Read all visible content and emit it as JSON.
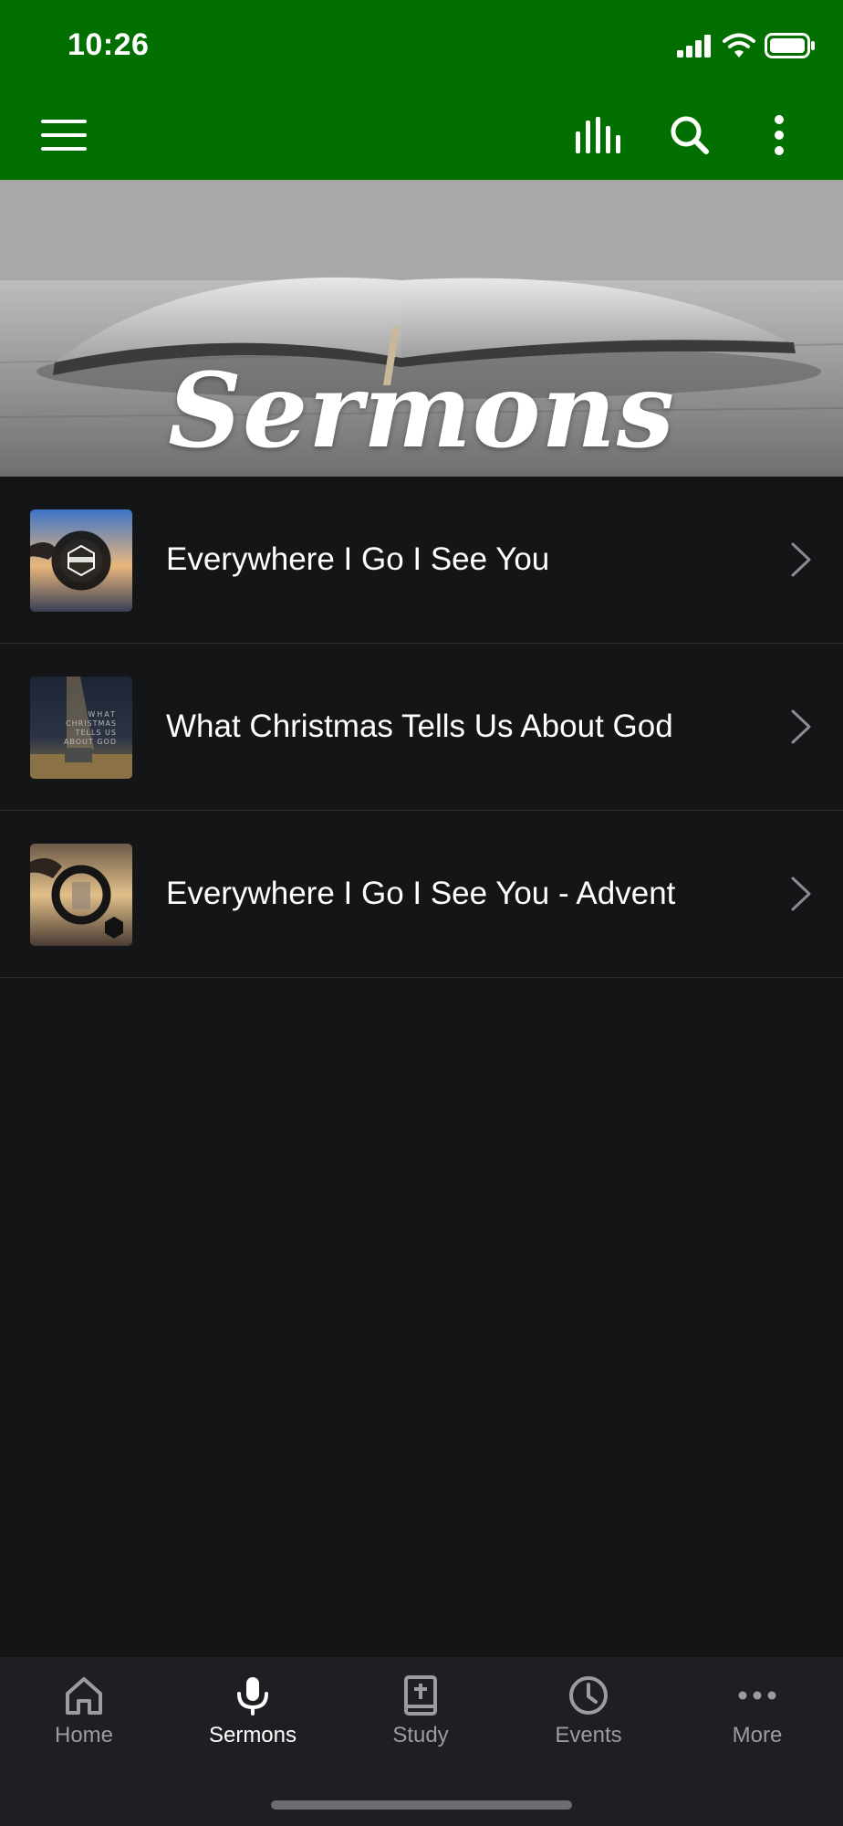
{
  "status_bar": {
    "time": "10:26"
  },
  "header": {
    "icons": [
      "menu-icon",
      "equalizer-icon",
      "search-icon",
      "more-vertical-icon"
    ]
  },
  "banner": {
    "title": "Sermons"
  },
  "sermons": [
    {
      "title": "Everywhere I Go I See You"
    },
    {
      "title": "What Christmas Tells Us About God"
    },
    {
      "title": "Everywhere I Go I See You - Advent"
    }
  ],
  "tabs": [
    {
      "label": "Home",
      "icon": "home-icon"
    },
    {
      "label": "Sermons",
      "icon": "microphone-icon",
      "active": true
    },
    {
      "label": "Study",
      "icon": "bible-icon"
    },
    {
      "label": "Events",
      "icon": "clock-icon"
    },
    {
      "label": "More",
      "icon": "more-horizontal-icon"
    }
  ],
  "colors": {
    "header": "#017001",
    "background": "#141517",
    "tabbar": "#1e1f22",
    "inactive_tab": "#9a9ca0"
  }
}
